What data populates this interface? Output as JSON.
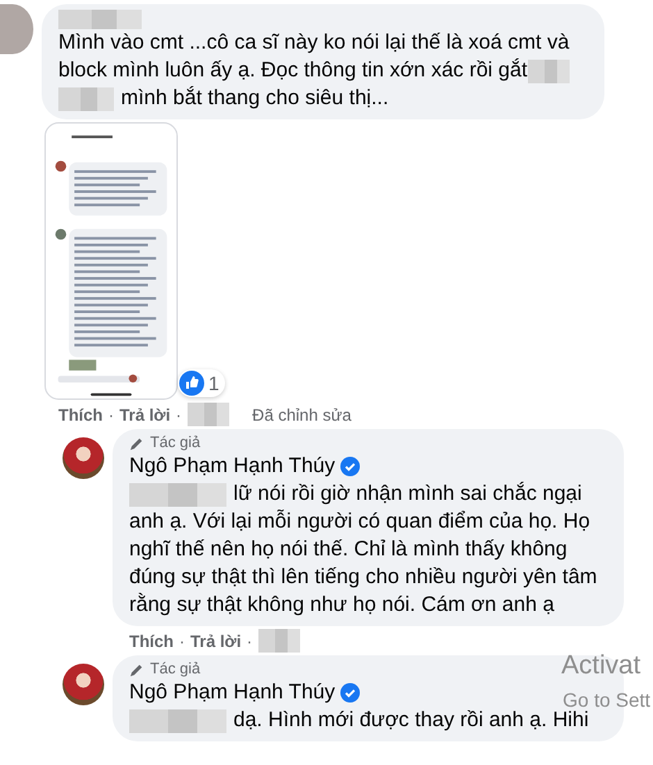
{
  "comments": [
    {
      "kind": "reply",
      "body": [
        {
          "parts": [
            {
              "kind": "text",
              "text": "Mình vào cmt ...cô ca sĩ này ko nói lại thế là xoá cmt và"
            }
          ]
        },
        {
          "parts": [
            {
              "kind": "text",
              "text": "block mình luôn ấy ạ. Đọc thông tin xớn xác rồi gắt"
            },
            {
              "kind": "redacted"
            }
          ]
        },
        {
          "parts": [
            {
              "kind": "redacted"
            },
            {
              "kind": "text",
              "text": "mình bắt thang cho siêu thị..."
            }
          ]
        }
      ],
      "attachment": true,
      "reactions": "1",
      "actions": [
        "Thích",
        "Trả lời"
      ],
      "separator": "·",
      "edited": "Đã chỉnh sửa"
    },
    {
      "kind": "author",
      "author_tag": "Tác giả",
      "author": "Ngô Phạm Hạnh Thúy",
      "verified": true,
      "body": [
        {
          "parts": [
            {
              "kind": "redacted"
            },
            {
              "kind": "text",
              "text": "lữ nói rồi giờ nhận mình sai chắc ngại"
            }
          ]
        },
        {
          "parts": [
            {
              "kind": "text",
              "text": "anh ạ. Với lại mỗi người có quan điểm của họ. Họ nghĩ thế nên họ nói thế. Chỉ là mình thấy không đúng sự thật thì lên tiếng cho nhiều người yên tâm rằng sự thật không như họ nói. Cám ơn anh ạ"
            }
          ]
        }
      ],
      "actions": [
        "Thích",
        "Trả lời"
      ],
      "separator": "·"
    },
    {
      "kind": "author",
      "author_tag": "Tác giả",
      "author": "Ngô Phạm Hạnh Thúy",
      "verified": true,
      "body": [
        {
          "parts": [
            {
              "kind": "redacted"
            },
            {
              "kind": "text",
              "text": "dạ. Hình mới được thay rồi anh ạ. Hihi"
            }
          ]
        }
      ]
    }
  ],
  "system_notice": [
    "Activat",
    "Go to Sett"
  ]
}
